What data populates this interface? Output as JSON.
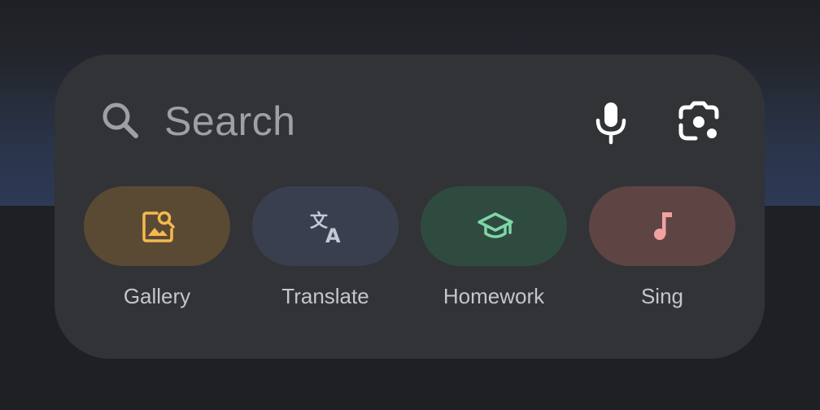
{
  "search": {
    "placeholder": "Search",
    "icon": "search-icon",
    "voice_icon": "mic-icon",
    "lens_icon": "lens-camera-icon"
  },
  "chips": [
    {
      "label": "Gallery",
      "icon": "gallery-search-icon",
      "bg": "#5b4a33",
      "fg": "#f5b94f"
    },
    {
      "label": "Translate",
      "icon": "translate-icon",
      "bg": "#3a3f50",
      "fg": "#c6c8d4"
    },
    {
      "label": "Homework",
      "icon": "graduation-cap-icon",
      "bg": "#2f4b3f",
      "fg": "#7fd6a9"
    },
    {
      "label": "Sing",
      "icon": "music-note-icon",
      "bg": "#5e4544",
      "fg": "#f0a2a2"
    }
  ],
  "colors": {
    "widget_bg": "#323337",
    "placeholder_text": "#9ea0a4",
    "label_text": "#c4c6ca",
    "icon_white": "#ffffff"
  }
}
